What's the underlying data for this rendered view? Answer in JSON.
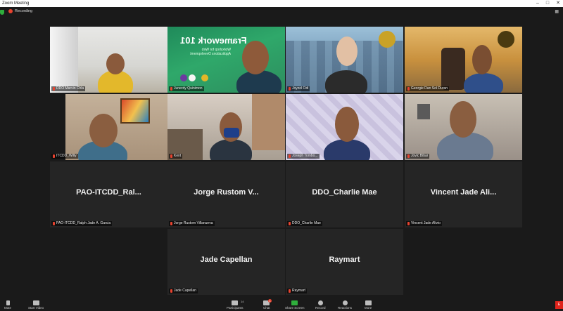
{
  "window": {
    "title": "Zoom Meeting"
  },
  "status": {
    "recording_label": "Recording"
  },
  "participants": [
    {
      "name": "DDO Marvin Chla",
      "muted": true
    },
    {
      "name": "Junerdy Quinimon",
      "muted": true,
      "active": true
    },
    {
      "name": "Joyzel Odi",
      "muted": true
    },
    {
      "name": "Georgie Dan Sol Duran",
      "muted": true
    },
    {
      "name": "ITCDD_Willy",
      "muted": true
    },
    {
      "name": "Kent",
      "muted": true
    },
    {
      "name": "Joseph Tombo...",
      "muted": true
    },
    {
      "name": "Jovic Bibar",
      "muted": true
    },
    {
      "display": "PAO-ITCDD_Ral...",
      "name": "PAO-ITCDD_Ralph Jade A. Garcia",
      "muted": true
    },
    {
      "display": "Jorge Rustom V...",
      "name": "Jorge Rustom Villanueva",
      "muted": true
    },
    {
      "display": "DDO_Charlie Mae",
      "name": "DDO_Charlie Mae",
      "muted": true
    },
    {
      "display": "Vincent Jade Ali...",
      "name": "Vincent Jade Alivio",
      "muted": true
    },
    {
      "display": "Jade Capellan",
      "name": "Jade Capellan",
      "muted": true
    },
    {
      "display": "Raymart",
      "name": "Raymart",
      "muted": true
    }
  ],
  "slide": {
    "text": "Framework 101",
    "subtitle": "Workshop for Web Applications Development"
  },
  "toolbar": {
    "mute": "Mute",
    "video": "Start Video",
    "participants": "Participants",
    "participants_count": "14",
    "chat": "Chat",
    "chat_badge": "1",
    "share": "Share Screen",
    "record": "Record",
    "reactions": "Reactions",
    "more": "More",
    "end": "E"
  }
}
